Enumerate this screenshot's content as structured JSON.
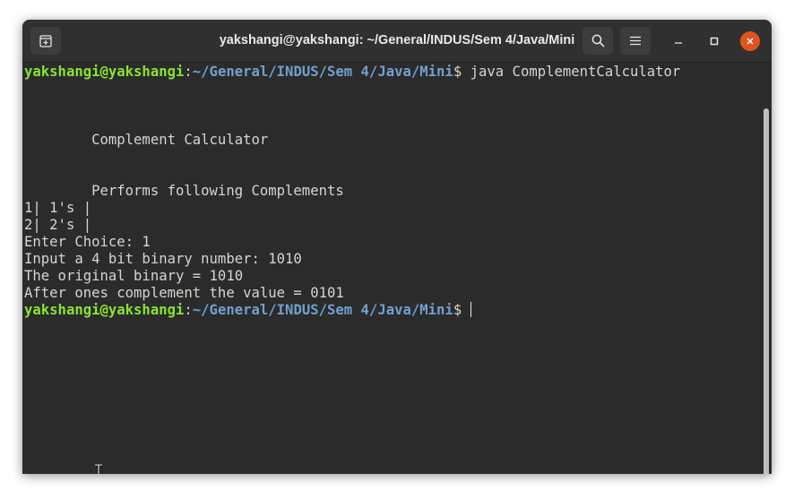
{
  "window": {
    "title": "yakshangi@yakshangi: ~/General/INDUS/Sem 4/Java/Mini"
  },
  "titlebar": {
    "new_tab_icon": "new-tab-icon",
    "search_icon": "search-icon",
    "menu_icon": "hamburger-menu-icon",
    "minimize_icon": "minimize-icon",
    "maximize_icon": "maximize-icon",
    "close_icon": "close-icon",
    "close_color": "#e0541f"
  },
  "terminal": {
    "prompt_user": "yakshangi@yakshangi",
    "prompt_colon": ":",
    "prompt_path": "~/General/INDUS/Sem 4/Java/Mini",
    "prompt_symbol": "$ ",
    "command": "java ComplementCalculator",
    "output": {
      "heading": "        Complement Calculator",
      "subheading": "        Performs following Complements",
      "option1": "1| 1's |",
      "option2": "2| 2's |",
      "choice": "Enter Choice: 1",
      "input": "Input a 4 bit binary number: 1010",
      "original": "The original binary = 1010",
      "result": "After ones complement the value = 0101"
    },
    "colors": {
      "background": "#2b2b2b",
      "text": "#d3d7cf",
      "user": "#8ae234",
      "path": "#729fcf"
    }
  }
}
